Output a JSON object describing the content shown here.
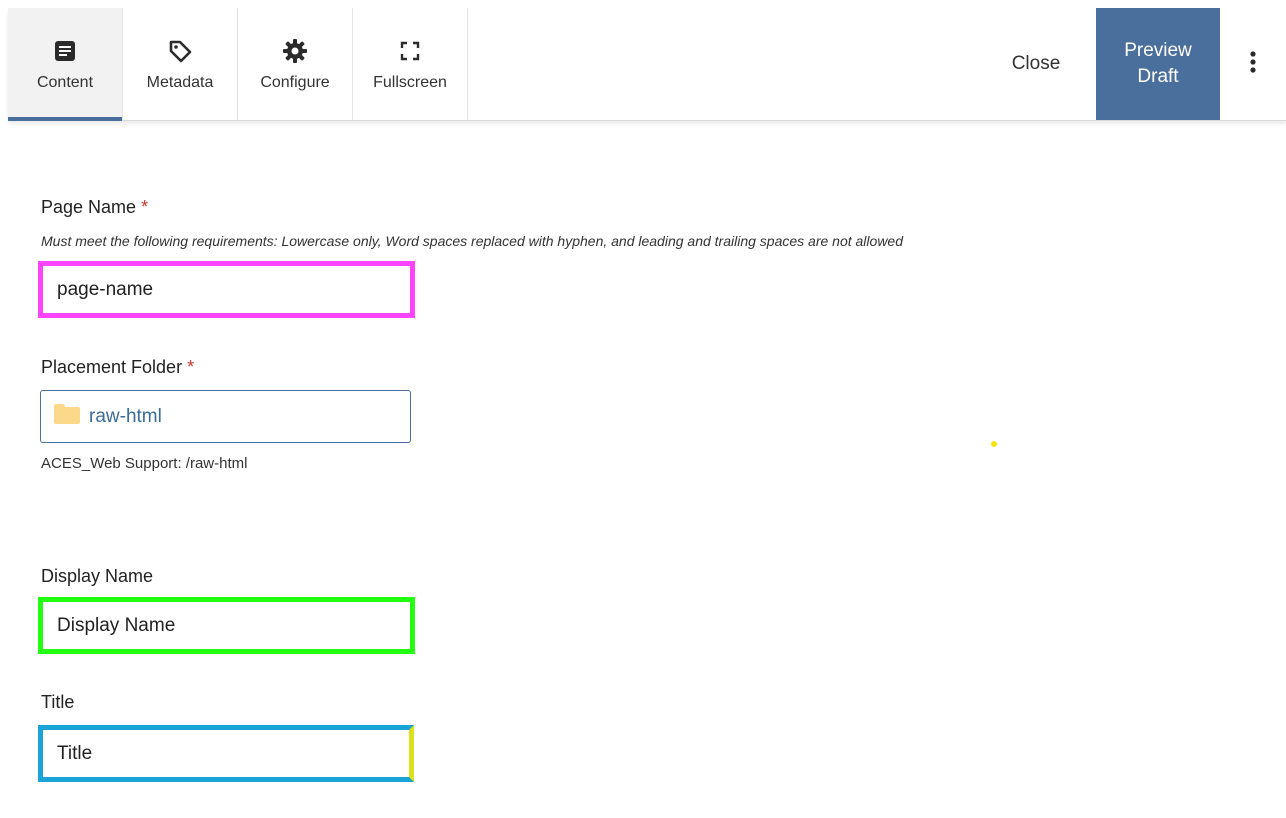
{
  "toolbar": {
    "tabs": [
      {
        "label": "Content",
        "icon": "document-icon"
      },
      {
        "label": "Metadata",
        "icon": "tag-icon"
      },
      {
        "label": "Configure",
        "icon": "gear-icon"
      },
      {
        "label": "Fullscreen",
        "icon": "fullscreen-icon"
      }
    ],
    "close_label": "Close",
    "preview_label": "Preview\nDraft",
    "more_icon": "vertical-dots-icon"
  },
  "form": {
    "page_name": {
      "label": "Page Name",
      "required_mark": "*",
      "hint": "Must meet the following requirements: Lowercase only, Word spaces replaced with hyphen, and leading and trailing spaces are not allowed",
      "value": "page-name"
    },
    "placement_folder": {
      "label": "Placement Folder",
      "required_mark": "*",
      "value": "raw-html",
      "path": "ACES_Web Support: /raw-html"
    },
    "display_name": {
      "label": "Display Name",
      "value": "Display Name"
    },
    "title": {
      "label": "Title",
      "value": "Title"
    }
  },
  "colors": {
    "accent": "#4a6f9c",
    "required": "#d0342c",
    "page_name_highlight": "#ff44ff",
    "display_name_highlight": "#22ff11",
    "title_highlight": "#1aa3d6"
  }
}
